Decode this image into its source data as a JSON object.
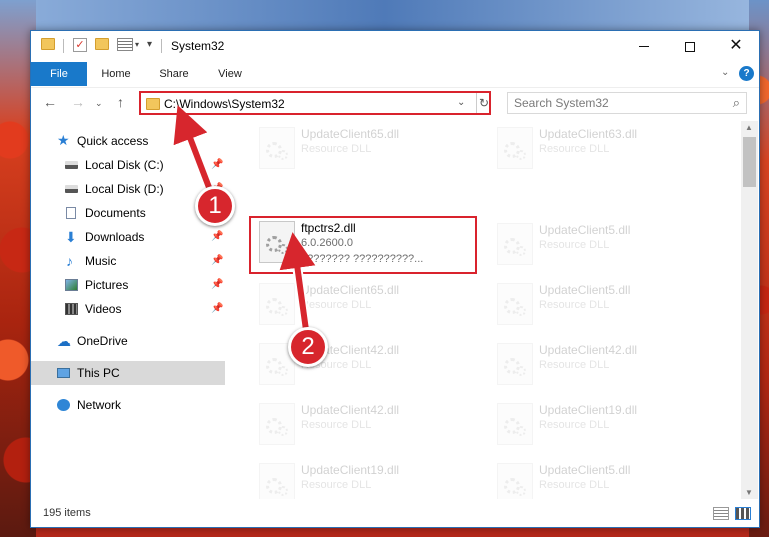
{
  "window": {
    "title": "System32"
  },
  "ribbon": {
    "tabs": [
      "File",
      "Home",
      "Share",
      "View"
    ],
    "help_icon": "?"
  },
  "nav": {
    "address": "C:\\Windows\\System32",
    "search_placeholder": "Search System32"
  },
  "sidebar": {
    "items": [
      {
        "label": "Quick access",
        "icon": "star-icon",
        "pinned": false
      },
      {
        "label": "Local Disk (C:)",
        "icon": "drive-icon",
        "pinned": true
      },
      {
        "label": "Local Disk (D:)",
        "icon": "drive-icon",
        "pinned": true
      },
      {
        "label": "Documents",
        "icon": "documents-icon",
        "pinned": true
      },
      {
        "label": "Downloads",
        "icon": "downloads-icon",
        "pinned": true
      },
      {
        "label": "Music",
        "icon": "music-icon",
        "pinned": true
      },
      {
        "label": "Pictures",
        "icon": "pictures-icon",
        "pinned": true
      },
      {
        "label": "Videos",
        "icon": "videos-icon",
        "pinned": true
      },
      {
        "label": "OneDrive",
        "icon": "onedrive-icon",
        "pinned": false
      },
      {
        "label": "This PC",
        "icon": "this-pc-icon",
        "pinned": false,
        "selected": true
      },
      {
        "label": "Network",
        "icon": "network-icon",
        "pinned": false
      }
    ]
  },
  "files": {
    "highlighted": {
      "name": "ftpctrs2.dll",
      "version": "6.0.2600.0",
      "description": "???????? ??????????..."
    },
    "items": [
      {
        "name": "UpdateClient65.dll",
        "type": "Resource DLL"
      },
      {
        "name": "UpdateClient63.dll",
        "type": "Resource DLL"
      },
      {
        "name": "UpdateClient5.dll",
        "type": "Resource DLL"
      },
      {
        "name": "UpdateClient65.dll",
        "type": "Resource DLL"
      },
      {
        "name": "UpdateClient5.dll",
        "type": "Resource DLL"
      },
      {
        "name": "UpdateClient42.dll",
        "type": "Resource DLL"
      },
      {
        "name": "UpdateClient42.dll",
        "type": "Resource DLL"
      },
      {
        "name": "UpdateClient42.dll",
        "type": "Resource DLL"
      },
      {
        "name": "UpdateClient19.dll",
        "type": "Resource DLL"
      },
      {
        "name": "UpdateClient19.dll",
        "type": "Resource DLL"
      },
      {
        "name": "UpdateClient5.dll",
        "type": "Resource DLL"
      }
    ]
  },
  "status": {
    "item_count": "195 items"
  },
  "annotations": {
    "step1": "1",
    "step2": "2",
    "color": "#d7262d"
  }
}
